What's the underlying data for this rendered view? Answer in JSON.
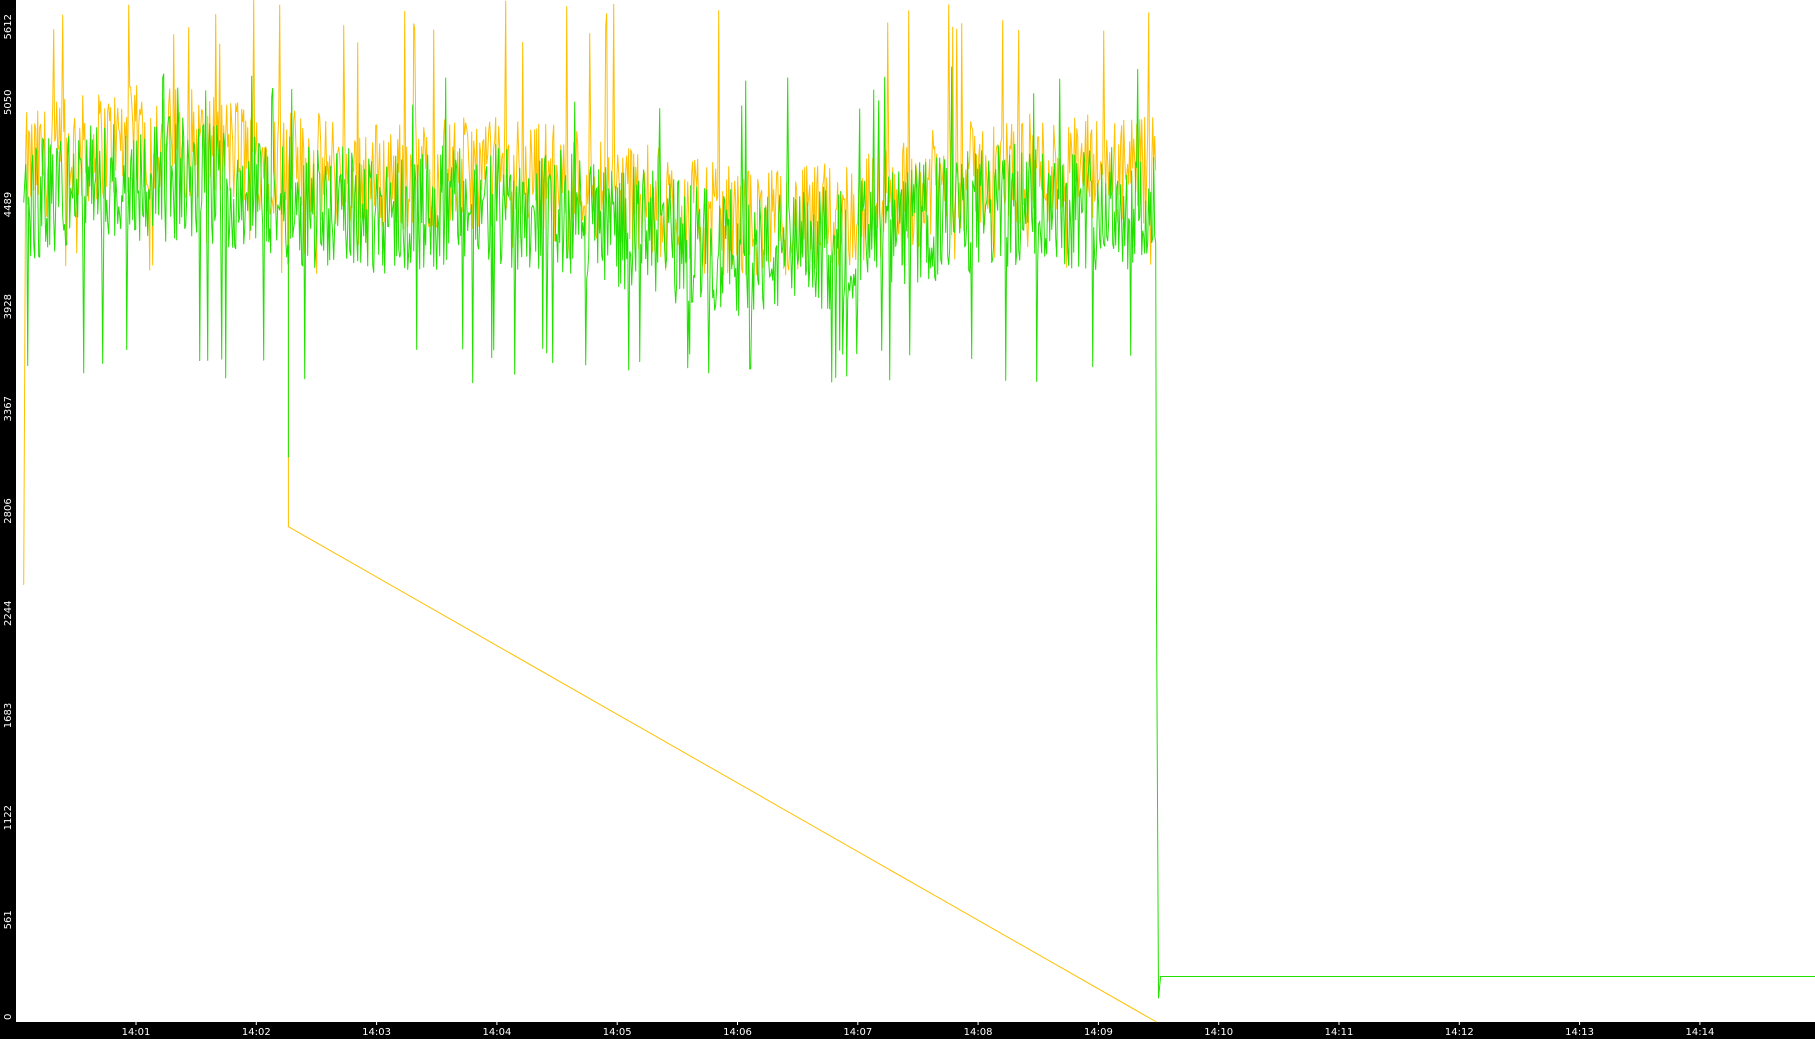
{
  "chart_data": {
    "type": "line",
    "title": "",
    "xlabel": "",
    "ylabel": "",
    "ylim": [
      0,
      5612
    ],
    "y_ticks": [
      "0",
      "561",
      "1122",
      "1683",
      "2244",
      "2806",
      "3367",
      "3928",
      "4489",
      "5050",
      "5612"
    ],
    "x_ticks": [
      "14:01",
      "14:02",
      "14:03",
      "14:04",
      "14:05",
      "14:06",
      "14:07",
      "14:08",
      "14:09",
      "14:10",
      "14:11",
      "14:12",
      "14:13",
      "14:14"
    ],
    "x_range": [
      "14:00:04",
      "14:14:59"
    ],
    "grid": false,
    "legend": "none",
    "background": "#000000",
    "plot_background": "#ffffff",
    "axis_color": "#000000",
    "tick_label_color": "#ffffff",
    "series": [
      {
        "color": "#ffc000",
        "approx_mean": 4620,
        "approx_range": [
          4100,
          5612
        ],
        "dips": [
          {
            "time": "14:02:16",
            "value": 2720
          }
        ],
        "key_points": [
          {
            "time": "14:00:04",
            "value": 2400
          },
          {
            "time": "14:00:10",
            "value": 4600
          },
          {
            "time": "14:03:32",
            "value": 5612
          },
          {
            "time": "14:06:30",
            "value": 5480
          },
          {
            "time": "14:09:28",
            "value": 4800
          },
          {
            "time": "14:09:29",
            "value": 0
          }
        ]
      },
      {
        "color": "#22e000",
        "approx_mean": 4430,
        "approx_range": [
          3500,
          5250
        ],
        "key_points": [
          {
            "time": "14:00:04",
            "value": 4500
          },
          {
            "time": "14:02:16",
            "value": 3100
          },
          {
            "time": "14:09:28",
            "value": 4100
          },
          {
            "time": "14:09:29",
            "value": 2300
          },
          {
            "time": "14:09:30",
            "value": 130
          },
          {
            "time": "14:09:31",
            "value": 250
          },
          {
            "time": "14:14:59",
            "value": 250
          }
        ]
      }
    ]
  }
}
